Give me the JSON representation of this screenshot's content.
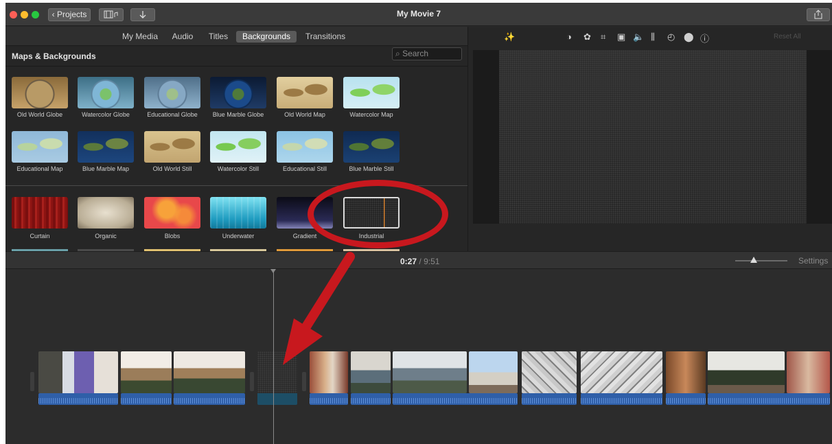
{
  "window": {
    "title": "My Movie 7"
  },
  "toolbar": {
    "projects_label": "Projects",
    "back_chevron": "‹",
    "media_icon": "film-music-icon",
    "import_icon": "download-arrow-icon",
    "share_icon": "share-icon"
  },
  "browser_tabs": [
    {
      "label": "My Media",
      "active": false
    },
    {
      "label": "Audio",
      "active": false
    },
    {
      "label": "Titles",
      "active": false
    },
    {
      "label": "Backgrounds",
      "active": true
    },
    {
      "label": "Transitions",
      "active": false
    }
  ],
  "section_title": "Maps & Backgrounds",
  "search": {
    "placeholder": "Search"
  },
  "maps_row1": [
    "Old World Globe",
    "Watercolor Globe",
    "Educational Globe",
    "Blue Marble Globe",
    "Old World Map",
    "Watercolor Map"
  ],
  "maps_row2": [
    "Educational Map",
    "Blue Marble Map",
    "Old World Still",
    "Watercolor Still",
    "Educational Still",
    "Blue Marble Still"
  ],
  "backgrounds": [
    "Curtain",
    "Organic",
    "Blobs",
    "Underwater",
    "Gradient",
    "Industrial"
  ],
  "viewer": {
    "tools": [
      "magic-wand-icon",
      "color-balance-icon",
      "color-palette-icon",
      "crop-icon",
      "stabilization-icon",
      "volume-icon",
      "equalizer-icon",
      "speed-icon",
      "filter-icon",
      "info-icon"
    ],
    "reset_label": "Reset All"
  },
  "timeline": {
    "current_time": "0:27",
    "separator": "/",
    "total_time": "9:51",
    "settings_label": "Settings",
    "zoom_level": 0.35
  },
  "colors": {
    "annotation": "#c8181e",
    "audio": "#2f5fa8",
    "background_clip": "#1d4e66"
  }
}
